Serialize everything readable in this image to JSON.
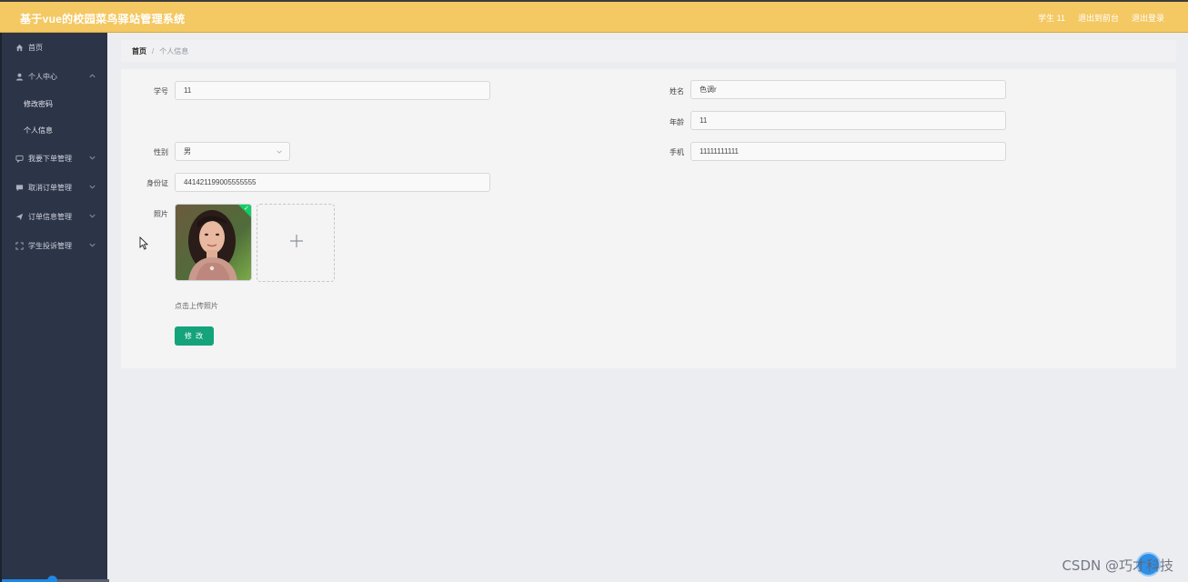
{
  "header": {
    "title": "基于vue的校园菜鸟驿站管理系统",
    "user_label": "学生 11",
    "exit_front_label": "退出到前台",
    "logout_label": "退出登录"
  },
  "sidebar": {
    "items": [
      {
        "label": "首页",
        "icon": "home-icon"
      },
      {
        "label": "个人中心",
        "icon": "user-icon",
        "expanded": true,
        "children": [
          "修改密码",
          "个人信息"
        ]
      },
      {
        "label": "我要下单管理",
        "icon": "chat-icon"
      },
      {
        "label": "取消订单管理",
        "icon": "message-icon"
      },
      {
        "label": "订单信息管理",
        "icon": "send-icon"
      },
      {
        "label": "学生投诉管理",
        "icon": "fullscreen-icon"
      }
    ]
  },
  "breadcrumb": {
    "home": "首页",
    "separator": "/",
    "current": "个人信息"
  },
  "form": {
    "student_id": {
      "label": "学号",
      "value": "11"
    },
    "name": {
      "label": "姓名",
      "value": "色调r"
    },
    "age": {
      "label": "年龄",
      "value": "11"
    },
    "gender": {
      "label": "性别",
      "value": "男"
    },
    "phone": {
      "label": "手机",
      "value": "11111111111"
    },
    "id_card": {
      "label": "身份证",
      "value": "441421199005555555"
    },
    "photo": {
      "label": "照片",
      "upload_hint": "点击上传照片"
    },
    "submit_label": "修 改"
  },
  "watermark": "CSDN @巧才科技",
  "colors": {
    "header": "#f4c862",
    "sidebar": "#2c3448",
    "primary_button": "#14a37a",
    "upload_success": "#13ce66"
  }
}
